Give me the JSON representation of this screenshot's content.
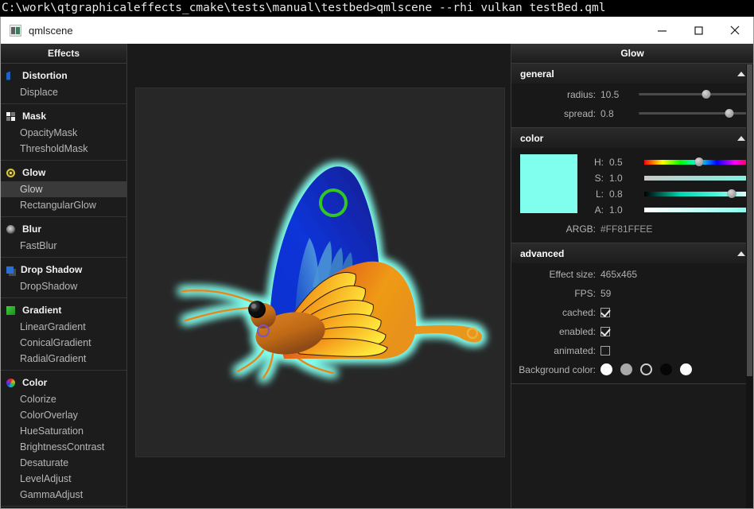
{
  "console": {
    "command_line": "C:\\work\\qtgraphicaleffects_cmake\\tests\\manual\\testbed>qmlscene --rhi vulkan testBed.qml"
  },
  "window": {
    "title": "qmlscene",
    "app_icon": "application-icon",
    "controls": {
      "minimize": "minimize-icon",
      "maximize": "maximize-icon",
      "close": "close-icon"
    }
  },
  "sidebar": {
    "header": "Effects",
    "groups": [
      {
        "icon": "distortion-icon",
        "title": "Distortion",
        "items": [
          "Displace"
        ]
      },
      {
        "icon": "mask-icon",
        "title": "Mask",
        "items": [
          "OpacityMask",
          "ThresholdMask"
        ]
      },
      {
        "icon": "glow-icon",
        "title": "Glow",
        "items": [
          "Glow",
          "RectangularGlow"
        ],
        "selected": "Glow"
      },
      {
        "icon": "blur-icon",
        "title": "Blur",
        "items": [
          "FastBlur"
        ]
      },
      {
        "icon": "dropshadow-icon",
        "title": "Drop Shadow",
        "items": [
          "DropShadow"
        ]
      },
      {
        "icon": "gradient-icon",
        "title": "Gradient",
        "items": [
          "LinearGradient",
          "ConicalGradient",
          "RadialGradient"
        ]
      },
      {
        "icon": "color-icon",
        "title": "Color",
        "items": [
          "Colorize",
          "ColorOverlay",
          "HueSaturation",
          "BrightnessContrast",
          "Desaturate",
          "LevelAdjust",
          "GammaAdjust"
        ]
      }
    ]
  },
  "viewport": {
    "scene_name": "butterfly-preview",
    "background_color": "#272727",
    "glow_color": "#81FFEE"
  },
  "inspector": {
    "header": "Glow",
    "sections": {
      "general": {
        "title": "general",
        "collapse_icon": "caret-up-icon",
        "params": [
          {
            "label": "radius:",
            "value": "10.5",
            "slider_pct": 62
          },
          {
            "label": "spread:",
            "value": "0.8",
            "slider_pct": 83
          }
        ]
      },
      "color": {
        "title": "color",
        "collapse_icon": "caret-up-icon",
        "swatch_color": "#81FFEE",
        "channels": [
          {
            "label": "H:",
            "value": "0.5",
            "slider_pct": 50
          },
          {
            "label": "S:",
            "value": "1.0",
            "slider_pct": 100
          },
          {
            "label": "L:",
            "value": "0.8",
            "slider_pct": 80
          },
          {
            "label": "A:",
            "value": "1.0",
            "slider_pct": 100
          }
        ],
        "argb_label": "ARGB:",
        "argb_value": "#FF81FFEE"
      },
      "advanced": {
        "title": "advanced",
        "collapse_icon": "caret-up-icon",
        "effect_size_label": "Effect size:",
        "effect_size_value": "465x465",
        "fps_label": "FPS:",
        "fps_value": "59",
        "cached_label": "cached:",
        "cached_checked": true,
        "enabled_label": "enabled:",
        "enabled_checked": true,
        "animated_label": "animated:",
        "animated_checked": false,
        "background_color_label": "Background color:",
        "background_swatches": [
          "#ffffff",
          "#a8a8a8",
          "#1a1a1a",
          "#060606",
          "#f0f0f0"
        ],
        "background_selected_index": 2
      }
    }
  }
}
